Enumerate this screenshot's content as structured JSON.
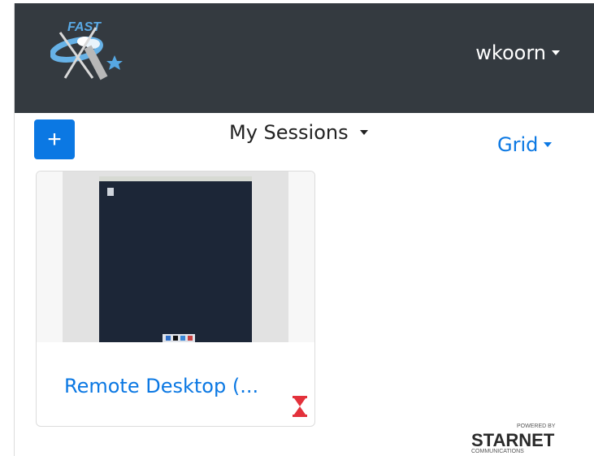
{
  "brand": {
    "logo_text": "FAST",
    "colors": {
      "navbar": "#343a40",
      "accent": "#0b78e3",
      "pending": "#e3313b"
    }
  },
  "header": {
    "user_name": "wkoorn"
  },
  "toolbar": {
    "add_label": "+",
    "sessions_label": "My Sessions",
    "view_label": "Grid"
  },
  "sessions": [
    {
      "title": "Remote Desktop (...",
      "status_icon": "hourglass-icon"
    }
  ],
  "footer": {
    "powered_by": "POWERED BY",
    "brand": "STARNET",
    "sub": "COMMUNICATIONS"
  }
}
